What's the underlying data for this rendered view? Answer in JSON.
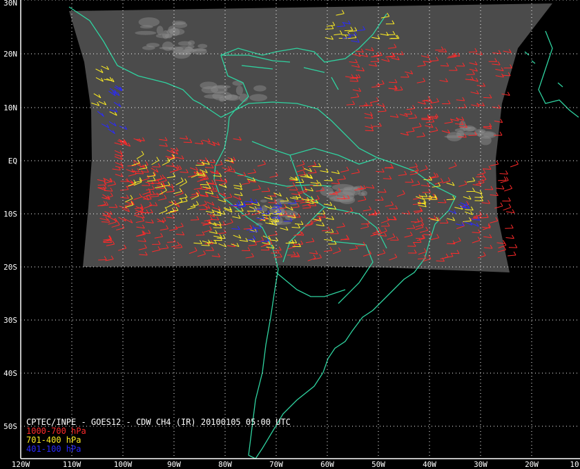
{
  "map": {
    "latitude_labels": [
      "30N",
      "20N",
      "10N",
      "EQ",
      "10S",
      "20S",
      "30S",
      "40S",
      "50S"
    ],
    "longitude_labels": [
      "120W",
      "110W",
      "100W",
      "90W",
      "80W",
      "70W",
      "60W",
      "50W",
      "40W",
      "30W",
      "20W",
      "10"
    ],
    "colors": {
      "background": "#000000",
      "grid": "#ffffff",
      "coastline": "#2fd3a0",
      "imagery": "#4a4a4a"
    }
  },
  "caption": {
    "title": "CPTEC/INPE - GOES12 - CDW CH4 (IR) 20100105 05:00 UTC",
    "legend": [
      {
        "label": "1000-700 hPa",
        "color": "#ff2a2a"
      },
      {
        "label": "701-400 hPa",
        "color": "#ffee22"
      },
      {
        "label": "401-100 hPa",
        "color": "#2a2aff"
      }
    ]
  }
}
